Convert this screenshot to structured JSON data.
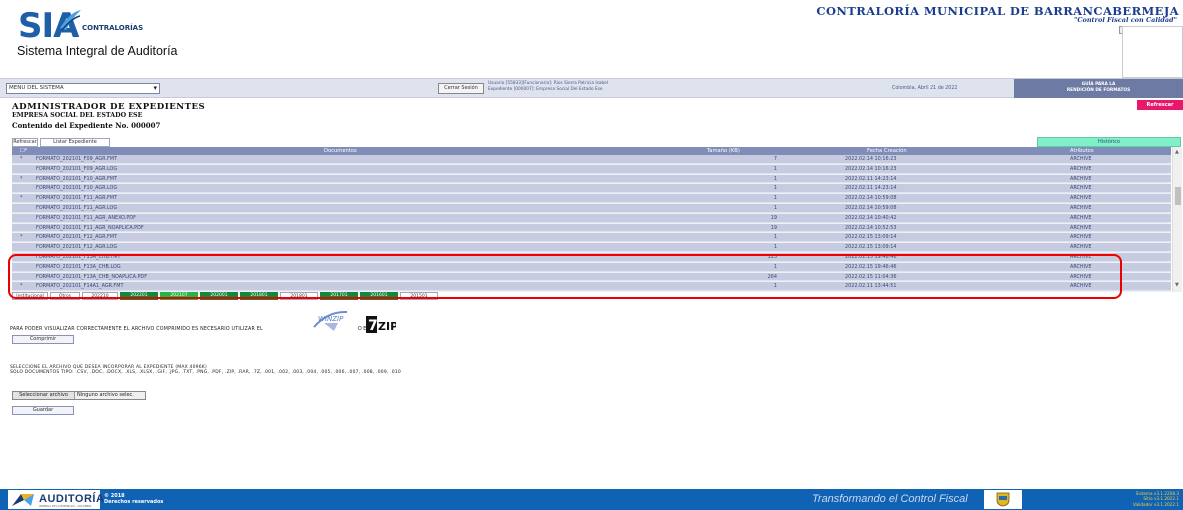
{
  "header": {
    "logo_text": "SIA",
    "logo_brand": "CONTRALORÍAS",
    "logo_subtitle": "Sistema Integral de Auditoría",
    "org_name": "CONTRALORÍA MUNICIPAL DE BARRANCABERMEJA",
    "org_motto": "\"Control Fiscal con Calidad\""
  },
  "bar": {
    "menu_label": "MENU DEL SISTEMA",
    "close_session": "Cerrar Sesión",
    "user_line": "Usuario [55833][Funcionario]: Rios Sierra Patricia Isabel",
    "file_line": "Expediente [000007]: Empresa Social Del Estado Ese",
    "date": "Colombia, Abril 21 de 2022",
    "guide_line1": "GUÍA PARA LA",
    "guide_line2": "RENDICIÓN DE FORMATOS"
  },
  "page": {
    "refresh_page": "Refrescar página",
    "title": "ADMINISTRADOR DE EXPEDIENTES",
    "entity": "EMPRESA SOCIAL DEL ESTADO ESE",
    "content": "Contenido del Expediente No. 000007",
    "btn_refresh": "Refrescar",
    "btn_list": "Listar Expediente",
    "btn_history": "Histórico"
  },
  "grid": {
    "headers": [
      "Documentos",
      "Tamaño (KB)",
      "Fecha Creación",
      "Atributos"
    ],
    "rows": [
      {
        "star": "*",
        "doc": "FORMATO_202101_F09_AGR.FMT",
        "size": "7",
        "date": "2022.02.14 10:16:23",
        "attr": "ARCHIVE"
      },
      {
        "star": "",
        "doc": "FORMATO_202101_F09_AGR.LOG",
        "size": "1",
        "date": "2022.02.14 10:16:23",
        "attr": "ARCHIVE"
      },
      {
        "star": "*",
        "doc": "FORMATO_202101_F10_AGR.FMT",
        "size": "1",
        "date": "2022.02.11 14:23:14",
        "attr": "ARCHIVE"
      },
      {
        "star": "",
        "doc": "FORMATO_202101_F10_AGR.LOG",
        "size": "1",
        "date": "2022.02.11 14:23:14",
        "attr": "ARCHIVE"
      },
      {
        "star": "*",
        "doc": "FORMATO_202101_F11_AGR.FMT",
        "size": "1",
        "date": "2022.02.14 10:59:08",
        "attr": "ARCHIVE"
      },
      {
        "star": "",
        "doc": "FORMATO_202101_F11_AGR.LOG",
        "size": "1",
        "date": "2022.02.14 10:59:08",
        "attr": "ARCHIVE"
      },
      {
        "star": "",
        "doc": "FORMATO_202101_F11_AGR_ANEXO.PDF",
        "size": "19",
        "date": "2022.02.14 10:40:42",
        "attr": "ARCHIVE"
      },
      {
        "star": "",
        "doc": "FORMATO_202101_F11_AGR_NOAPLICA.PDF",
        "size": "19",
        "date": "2022.02.14 10:52:53",
        "attr": "ARCHIVE"
      },
      {
        "star": "*",
        "doc": "FORMATO_202101_F12_AGR.FMT",
        "size": "1",
        "date": "2022.02.15 13:09:14",
        "attr": "ARCHIVE"
      },
      {
        "star": "",
        "doc": "FORMATO_202101_F12_AGR.LOG",
        "size": "1",
        "date": "2022.02.15 13:09:14",
        "attr": "ARCHIVE"
      },
      {
        "star": "*",
        "doc": "FORMATO_202101_F13A_CHB.FMT",
        "size": "123",
        "date": "2022.02.15 19:46:46",
        "attr": "ARCHIVE"
      },
      {
        "star": "",
        "doc": "FORMATO_202101_F13A_CHB.LOG",
        "size": "1",
        "date": "2022.02.15 19:46:46",
        "attr": "ARCHIVE"
      },
      {
        "star": "",
        "doc": "FORMATO_202101_F13A_CHB_NOAPLICA.PDF",
        "size": "264",
        "date": "2022.02.15 11:04:36",
        "attr": "ARCHIVE"
      },
      {
        "star": "*",
        "doc": "FORMATO_202101_F14A1_AGR.FMT",
        "size": "1",
        "date": "2022.02.11 13:44:51",
        "attr": "ARCHIVE"
      }
    ]
  },
  "period_tabs": [
    {
      "label": "Institucional",
      "style": "w"
    },
    {
      "label": "Otros",
      "style": "w"
    },
    {
      "label": "202210",
      "style": "w"
    },
    {
      "label": "202201",
      "style": "g"
    },
    {
      "label": "202107",
      "style": "gl"
    },
    {
      "label": "202001",
      "style": "g"
    },
    {
      "label": "201801",
      "style": "g"
    },
    {
      "label": "201801",
      "style": "w"
    },
    {
      "label": "201701",
      "style": "g"
    },
    {
      "label": "201601",
      "style": "g"
    },
    {
      "label": "201501",
      "style": "w"
    }
  ],
  "upload": {
    "compress_msg": "PARA PODER VISUALIZAR CORRECTAMENTE EL ARCHIVO COMPRIMIDO ES NECESARIO UTILIZAR EL",
    "or_text": "O EL",
    "winzip_label": "WINZIP",
    "zip_label": "ZIP",
    "btn_compress": "Comprimir",
    "select_msg": "SELECCIONE EL ARCHIVO QUE DESEA INCORPORAR AL EXPEDIENTE (MAX 4096K)",
    "types_msg": "SOLO DOCUMENTOS TIPO: .CSV, .DOC, .DOCX, .XLS, .XLSX, .GIF, .JPG, .TXT, .PNG, .PDF, .ZIP, .RAR, .7Z, .001, .002, .003, .004, .005, .006, .007, .008, .009, .010",
    "btn_choose": "Seleccionar archivo",
    "no_file": "Ninguno archivo selec.",
    "btn_save": "Guardar"
  },
  "footer": {
    "audit_logo": "AUDITORÍA",
    "audit_logo_sub": "GENERAL DE LA REPÚBLICA · COLOMBIA",
    "copy_year": "© 2018",
    "copy_rights": "Derechos reservados",
    "slogan": "Transformando el Control Fiscal",
    "ver1": "Sistema v3.1.2208.3",
    "ver2": "Sitio v3.1.2022.1",
    "ver3": "Validador v3.1.2022.1"
  },
  "colors": {
    "header_band": "#7f8db8",
    "row": "#c6cbe0",
    "highlight": "#e00000",
    "footer": "#1062b5",
    "green": "#0f8a3b"
  }
}
